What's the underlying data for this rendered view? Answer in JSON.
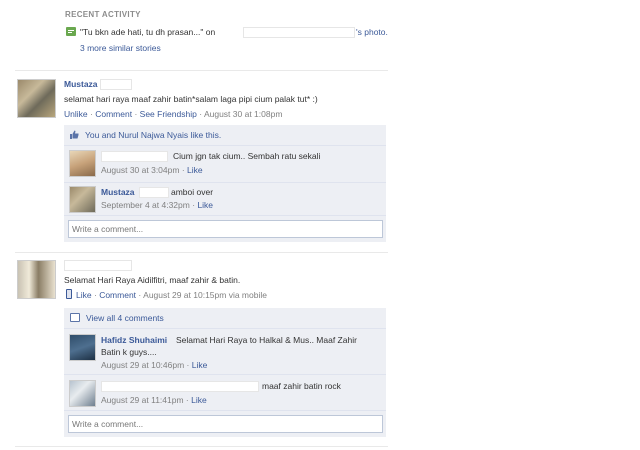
{
  "recent_activity": {
    "heading": "RECENT ACTIVITY",
    "story_prefix": "\"Tu bkn ade hati, tu dh prasan...\" on",
    "story_suffix": "'s photo.",
    "more_link": "3 more similar stories"
  },
  "post1": {
    "author": "Mustaza",
    "message": "selamat hari raya maaf zahir batin*salam laga pipi cium palak tut* :)",
    "actions": {
      "unlike": "Unlike",
      "comment": "Comment",
      "see_friendship": "See Friendship",
      "timestamp": "August 30 at 1:08pm"
    },
    "likes_text": "You and Nurul Najwa Nyais like this.",
    "comments": [
      {
        "author": "",
        "text": "Cium jgn tak cium.. Sembah ratu sekali",
        "timestamp": "August 30 at 3:04pm",
        "like": "Like"
      },
      {
        "author": "Mustaza",
        "text": "amboi over",
        "timestamp": "September 4 at 4:32pm",
        "like": "Like"
      }
    ],
    "comment_placeholder": "Write a comment..."
  },
  "post2": {
    "message": "Selamat Hari Raya Aidilfitri, maaf zahir & batin.",
    "actions": {
      "like": "Like",
      "comment": "Comment",
      "timestamp": "August 29 at 10:15pm via mobile"
    },
    "view_all": "View all 4 comments",
    "comments": [
      {
        "author": "Hafidz Shuhaimi",
        "text_line1": "Selamat Hari Raya to Halkal & Mus.. Maaf Zahir",
        "text_line2": "Batin k guys....",
        "timestamp": "August 29 at 10:46pm",
        "like": "Like"
      },
      {
        "author": "",
        "text": "maaf zahir batin rock",
        "timestamp": "August 29 at 11:41pm",
        "like": "Like"
      }
    ],
    "comment_placeholder": "Write a comment..."
  },
  "separator": "·",
  "colors": {
    "link": "#3b5998",
    "box_bg": "#edeff4",
    "muted": "#808080"
  }
}
